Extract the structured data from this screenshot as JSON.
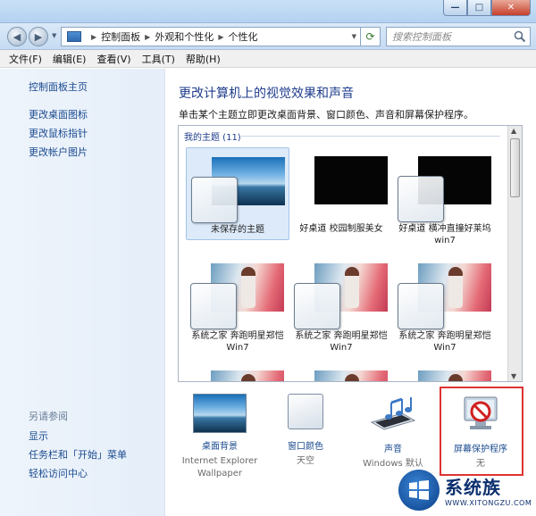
{
  "window": {
    "controls": {
      "min": "—",
      "max": "□",
      "close": "✕"
    }
  },
  "address": {
    "crumbs": [
      "控制面板",
      "外观和个性化",
      "个性化"
    ],
    "search_placeholder": "搜索控制面板"
  },
  "menu": [
    "文件(F)",
    "编辑(E)",
    "查看(V)",
    "工具(T)",
    "帮助(H)"
  ],
  "sidebar": {
    "home": "控制面板主页",
    "links": [
      "更改桌面图标",
      "更改鼠标指针",
      "更改帐户图片"
    ],
    "see_also_title": "另请参阅",
    "see_also": [
      "显示",
      "任务栏和「开始」菜单",
      "轻松访问中心"
    ]
  },
  "main": {
    "title": "更改计算机上的视觉效果和声音",
    "subtitle": "单击某个主题立即更改桌面背景、窗口颜色、声音和屏幕保护程序。",
    "group_header": "我的主题 (11)",
    "themes": [
      {
        "label": "未保存的主题",
        "style": "sky",
        "selected": true
      },
      {
        "label": "好桌道 校园制服美女",
        "style": "black",
        "selected": false
      },
      {
        "label": "好桌道 横冲直撞好莱坞win7",
        "style": "black",
        "selected": false
      },
      {
        "label": "系统之家 奔跑明星郑恺Win7",
        "style": "girl",
        "selected": false
      },
      {
        "label": "系统之家 奔跑明星郑恺Win7",
        "style": "girl",
        "selected": false
      },
      {
        "label": "系统之家 奔跑明星郑恺Win7",
        "style": "girl",
        "selected": false
      }
    ]
  },
  "bottom": [
    {
      "label": "桌面背景",
      "sub": "Internet Explorer Wallpaper"
    },
    {
      "label": "窗口颜色",
      "sub": "天空"
    },
    {
      "label": "声音",
      "sub": "Windows 默认"
    },
    {
      "label": "屏幕保护程序",
      "sub": "无"
    }
  ],
  "watermark": {
    "main": "系统族",
    "sub": "WWW.XITONGZU.COM"
  },
  "colors": {
    "link": "#1a4a8f",
    "title": "#1e3c8c",
    "highlight_frame": "#dd3333"
  }
}
